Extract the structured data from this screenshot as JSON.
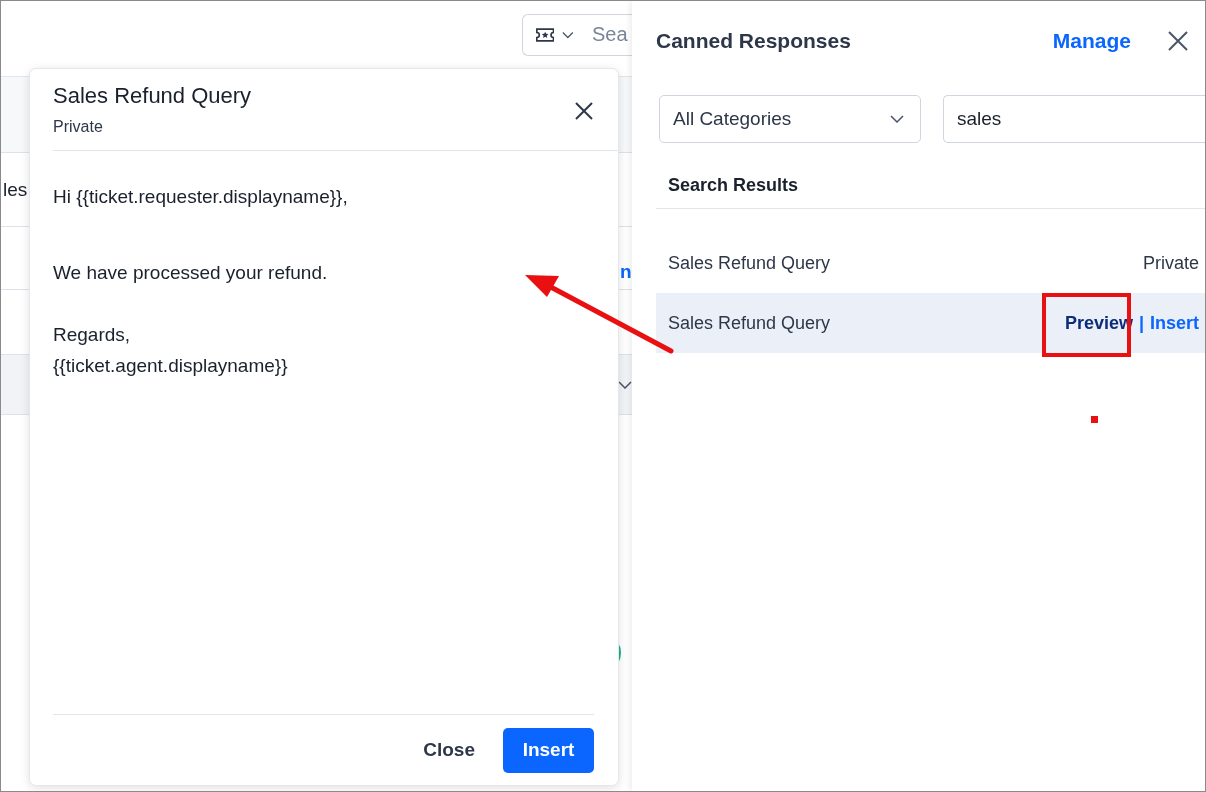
{
  "background": {
    "search": {
      "placeholder": "Sea"
    },
    "fragments": [
      {
        "text": "les",
        "kind": "label"
      },
      {
        "text": "n",
        "kind": "link"
      }
    ]
  },
  "preview": {
    "title": "Sales Refund Query",
    "visibility": "Private",
    "paragraphs": [
      [
        "Hi {{ticket.requester.displayname}},"
      ],
      [
        "We have processed your refund."
      ],
      [
        "Regards,",
        "{{ticket.agent.displayname}}"
      ]
    ],
    "buttons": [
      {
        "label": "Close",
        "kind": "text"
      },
      {
        "label": "Insert",
        "kind": "primary"
      }
    ]
  },
  "panel": {
    "title": "Canned Responses",
    "manage": "Manage",
    "category": "All Categories",
    "search": {
      "value": "sales"
    },
    "section": "Search Results",
    "results": [
      {
        "name": "Sales Refund Query",
        "visibility": "Private",
        "selected": false
      },
      {
        "name": "Sales Refund Query",
        "selected": true,
        "actions": [
          "Preview",
          "Insert"
        ],
        "separator": "|"
      }
    ]
  }
}
